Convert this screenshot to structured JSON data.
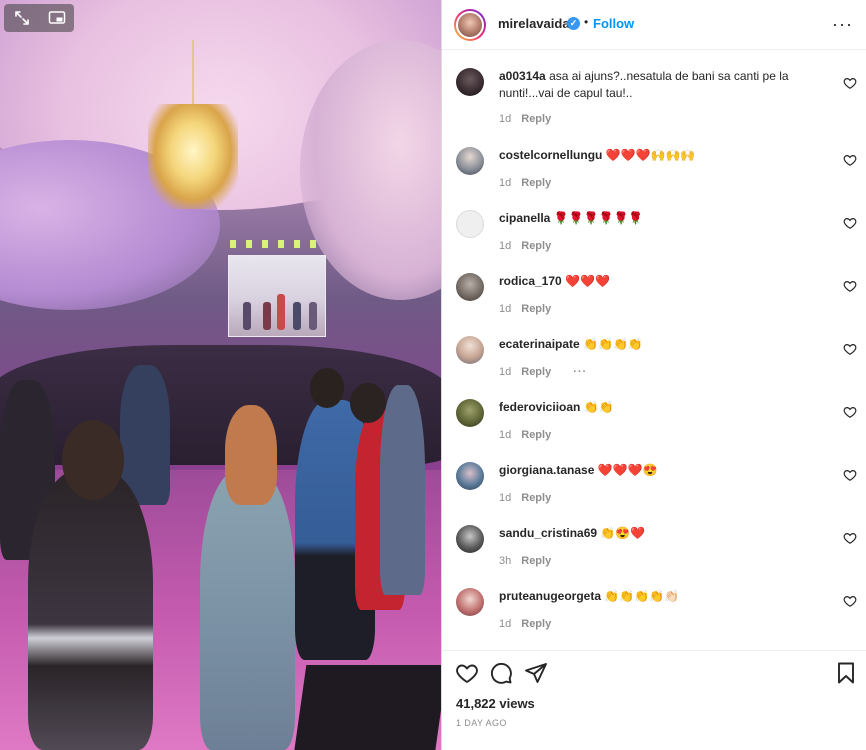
{
  "media": {
    "expand_icon": "expand-arrows-icon",
    "pip_icon": "picture-in-picture-icon"
  },
  "header": {
    "username": "mirelavaida",
    "verified": "✓",
    "separator": "•",
    "follow_label": "Follow",
    "more_label": "···"
  },
  "comments": [
    {
      "user": "a00314a",
      "text": "asa ai ajuns?..nesatula de bani sa canti pe la nunti!...vai de capul tau!..",
      "age": "1d",
      "reply": "Reply"
    },
    {
      "user": "costelcornellungu",
      "text": "❤️❤️❤️🙌🙌🙌",
      "age": "1d",
      "reply": "Reply"
    },
    {
      "user": "cipanella",
      "text": "🌹🌹🌹🌹🌹🌹",
      "age": "1d",
      "reply": "Reply"
    },
    {
      "user": "rodica_170",
      "text": "❤️❤️❤️",
      "age": "1d",
      "reply": "Reply"
    },
    {
      "user": "ecaterinaipate",
      "text": "👏👏👏👏",
      "age": "1d",
      "reply": "Reply",
      "more": "···"
    },
    {
      "user": "federoviciioan",
      "text": "👏👏",
      "age": "1d",
      "reply": "Reply"
    },
    {
      "user": "giorgiana.tanase",
      "text": "❤️❤️❤️😍",
      "age": "1d",
      "reply": "Reply"
    },
    {
      "user": "sandu_cristina69",
      "text": "👏😍❤️",
      "age": "3h",
      "reply": "Reply"
    },
    {
      "user": "pruteanugeorgeta",
      "text": "👏👏👏👏👏🏻",
      "age": "1d",
      "reply": "Reply"
    }
  ],
  "footer": {
    "views": "41,822 views",
    "time_ago": "1 DAY AGO"
  },
  "colors": {
    "link": "#0095f6",
    "secondary_text": "#8e8e8e",
    "verified": "#3897f0"
  }
}
